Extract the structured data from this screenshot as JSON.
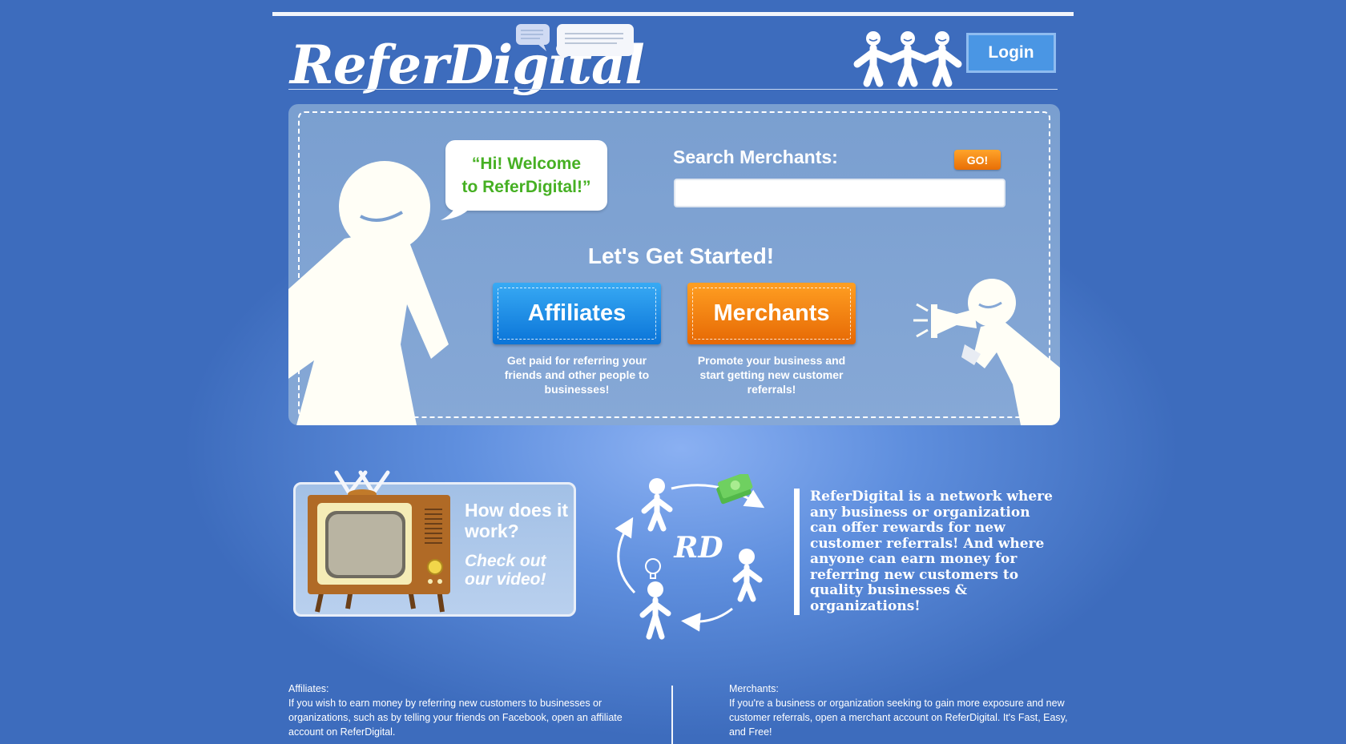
{
  "header": {
    "logo_text": "ReferDigital",
    "login_label": "Login"
  },
  "hero": {
    "bubble_line1": "“Hi! Welcome",
    "bubble_line2": "to ReferDigital!”",
    "search_label": "Search Merchants:",
    "search_placeholder": "",
    "search_value": "",
    "go_label": "GO!",
    "started_heading": "Let's Get Started!",
    "affiliates": {
      "label": "Affiliates",
      "description": "Get paid for referring your friends and other people to businesses!"
    },
    "merchants": {
      "label": "Merchants",
      "description": "Promote your business and start getting new customer referrals!"
    }
  },
  "video": {
    "title": "How does it work?",
    "subtitle": "Check out our video!"
  },
  "cycle": {
    "center_text": "RD"
  },
  "about": {
    "text": "ReferDigital is a network where any business or organization can offer rewards for new customer referrals! And where anyone can earn money for referring new customers to quality businesses & organizations!"
  },
  "footer": {
    "affiliates_title": "Affiliates:",
    "affiliates_text": "If you wish to earn money by referring new customers to businesses or organizations, such as by telling your friends on Facebook, open an affiliate account on ReferDigital.",
    "merchants_title": "Merchants:",
    "merchants_text": "If you're a business or organization seeking to gain more exposure and new customer referrals, open a merchant account on ReferDigital. It's Fast, Easy, and Free!"
  },
  "colors": {
    "background": "#3d6cbd",
    "affiliates_blue": "#1e8ee6",
    "merchants_orange": "#f2820f",
    "welcome_green": "#46b023",
    "login_blue": "#4a96e4"
  }
}
